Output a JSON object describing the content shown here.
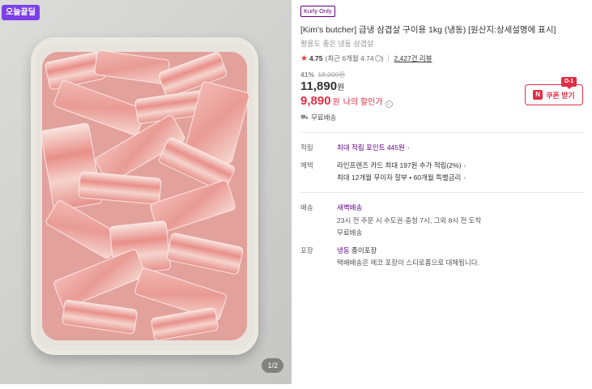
{
  "gallery": {
    "badge": "오늘끝딜",
    "pager": "1/2"
  },
  "product": {
    "label_badge": "Kurly Only",
    "title": "[Kim's butcher] 급냉 삼겹살 구이용 1kg (냉동) [원산지:상세설명에 표시]",
    "subtitle": "활용도 좋은 냉동 삼겹살",
    "rating": "4.75",
    "rating_recent": "(최근 6개월 4.74",
    "rating_recent_close": ")",
    "review_count": "2,427건 리뷰",
    "discount_rate": "41%",
    "original_price": "18,000원",
    "price": "11,890",
    "price_unit": "원",
    "my_price": "9,890",
    "my_price_unit": "원",
    "my_price_label": "나의 할인가",
    "free_shipping": "무료배송"
  },
  "coupon": {
    "dday": "D-1",
    "n_mark": "N",
    "label": "쿠폰 받기"
  },
  "details": {
    "points": {
      "label": "적립",
      "value": "최대 적립 포인트 445원"
    },
    "benefits": {
      "label": "혜택",
      "line1": "라인프렌즈 카드 최대 197원 추가 적립(2%)",
      "line2": "최대 12개월 무이자 할부 • 60개월 특별금리"
    },
    "delivery": {
      "label": "배송",
      "type": "새벽배송",
      "desc": "23시 전 주문 시 수도권·충청 7시, 그외 8시 전 도착",
      "free": "무료배송"
    },
    "packaging": {
      "label": "포장",
      "type_strong": "냉동",
      "type_rest": " 종이포장",
      "desc": "택배배송은 에코 포장이 스티로폼으로 대체됩니다."
    }
  },
  "colors": {
    "kurly_purple": "#5f0080",
    "accent_red": "#e02f44",
    "badge_purple": "#7b40e8"
  },
  "icons": {
    "star": "star-icon",
    "info": "info-icon",
    "chevron": "chevron-right-icon",
    "truck": "truck-icon"
  }
}
